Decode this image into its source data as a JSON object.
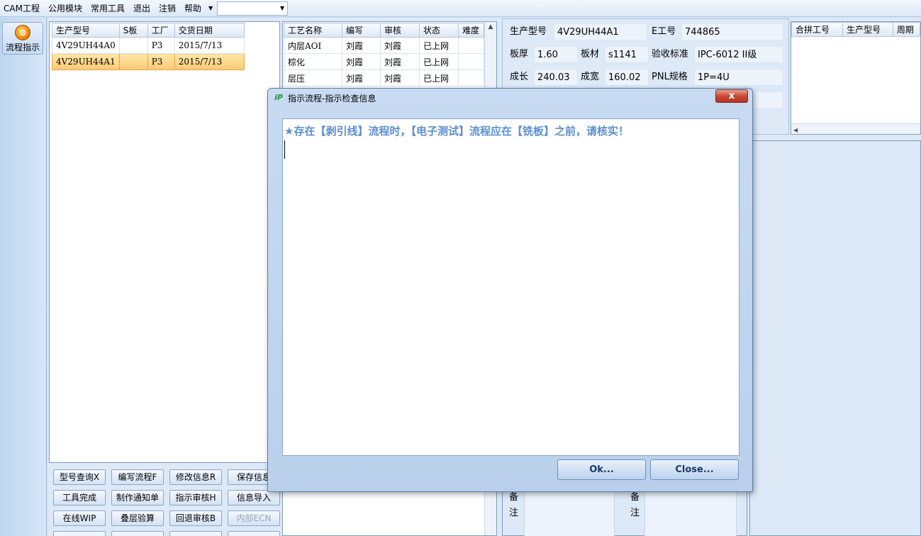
{
  "menu": {
    "items": [
      "CAM工程",
      "公用模块",
      "常用工具",
      "退出",
      "注销",
      "帮助"
    ],
    "combo_value": ""
  },
  "nav": {
    "flow_button_label": "流程指示"
  },
  "orders_grid": {
    "columns": [
      "生产型号",
      "S板",
      "工厂",
      "交货日期"
    ],
    "rows": [
      [
        "4V29UH44A0",
        "",
        "P3",
        "2015/7/13"
      ],
      [
        "4V29UH44A1",
        "",
        "P3",
        "2015/7/13"
      ]
    ],
    "selected_index": 1
  },
  "process_grid": {
    "columns": [
      "工艺名称",
      "编写",
      "审核",
      "状态",
      "难度"
    ],
    "rows": [
      [
        "内层AOI",
        "刘霞",
        "刘霞",
        "已上网",
        ""
      ],
      [
        "棕化",
        "刘霞",
        "刘霞",
        "已上网",
        ""
      ],
      [
        "层压",
        "刘霞",
        "刘霞",
        "已上网",
        ""
      ]
    ]
  },
  "info": {
    "model_label": "生产型号",
    "model_value": "4V29UH44A1",
    "ework_label": "E工号",
    "ework_value": "744865",
    "thickness_label": "板厚",
    "thickness_value": "1.60",
    "material_label": "板材",
    "material_value": "s1141",
    "standard_label": "验收标准",
    "standard_value": "IPC-6012 II级",
    "length_label": "成长",
    "length_value": "240.03",
    "width_label": "成宽",
    "width_value": "160.02",
    "pnl_label": "PNL规格",
    "pnl_value": "1P=4U"
  },
  "merge_grid": {
    "columns": [
      "合拼工号",
      "生产型号",
      "周期"
    ]
  },
  "remarks": {
    "label_a": "备注",
    "label_b": "备注"
  },
  "buttons": {
    "row1": [
      "型号查询X",
      "编写流程F",
      "修改信息R",
      "保存信息"
    ],
    "row2": [
      "工具完成",
      "制作通知单",
      "指示审核H",
      "信息导入"
    ],
    "row3": [
      "在线WIP",
      "叠层验算",
      "回退审核B",
      "内部ECN"
    ]
  },
  "dialog": {
    "title": "指示流程-指示检查信息",
    "close_glyph": "x",
    "message": "★存在【剥引线】流程时，【电子测试】流程应在【铣板】之前，请核实！",
    "ok_label": "Ok...",
    "close_label": "Close..."
  }
}
